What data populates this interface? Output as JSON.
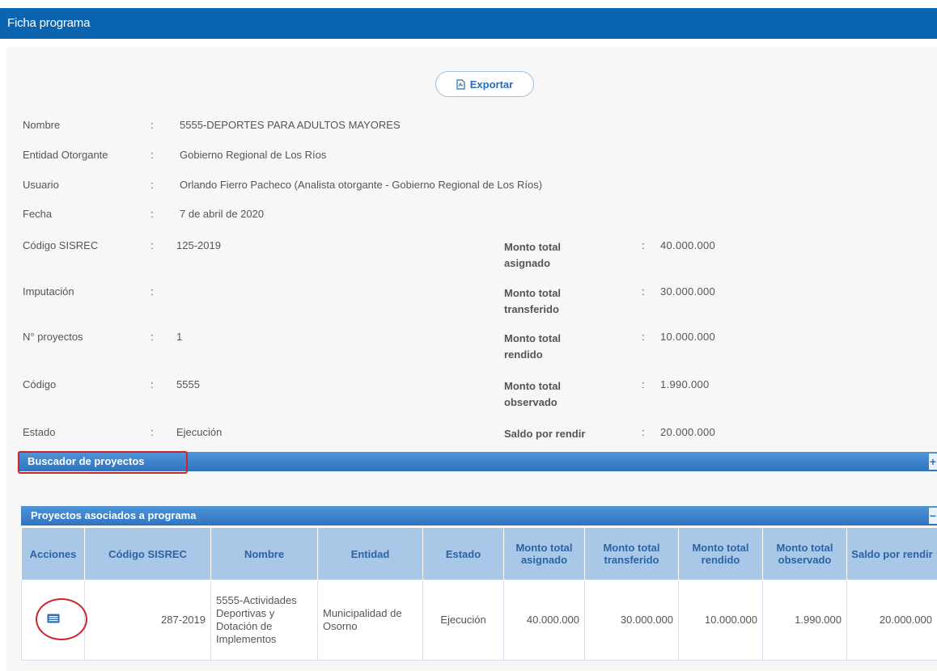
{
  "header": {
    "title": "Ficha programa"
  },
  "toolbar": {
    "export_label": "Exportar"
  },
  "info": {
    "nombre": {
      "label": "Nombre",
      "value": "5555-DEPORTES PARA ADULTOS MAYORES"
    },
    "entidad": {
      "label": "Entidad Otorgante",
      "value": "Gobierno Regional de Los Ríos"
    },
    "usuario": {
      "label": "Usuario",
      "value": "Orlando Fierro Pacheco (Analista otorgante - Gobierno Regional de Los Ríos)"
    },
    "fecha": {
      "label": "Fecha",
      "value": "7 de abril de 2020"
    },
    "colon": ":"
  },
  "details": {
    "codigo_sisrec": {
      "label": "Código SISREC",
      "value": "125-2019"
    },
    "imputacion": {
      "label": "Imputación",
      "value": ""
    },
    "n_proyectos": {
      "label": "N° proyectos",
      "value": "1"
    },
    "codigo": {
      "label": "Código",
      "value": "5555"
    },
    "estado": {
      "label": "Estado",
      "value": "Ejecución"
    },
    "monto_asignado": {
      "label": "Monto total asignado",
      "value": "40.000.000"
    },
    "monto_transferido": {
      "label": "Monto total transferido",
      "value": "30.000.000"
    },
    "monto_rendido": {
      "label": "Monto total rendido",
      "value": "10.000.000"
    },
    "monto_observado": {
      "label": "Monto total observado",
      "value": "1.990.000"
    },
    "saldo": {
      "label": "Saldo por rendir",
      "value": "20.000.000"
    }
  },
  "buscador": {
    "title": "Buscador de proyectos",
    "toggle": "+"
  },
  "proyectos": {
    "title": "Proyectos asociados a programa",
    "toggle": "−",
    "columns": [
      "Acciones",
      "Código SISREC",
      "Nombre",
      "Entidad",
      "Estado",
      "Monto total asignado",
      "Monto total transferido",
      "Monto total rendido",
      "Monto total observado",
      "Saldo por rendir"
    ],
    "rows": [
      {
        "codigo": "287-2019",
        "nombre": "5555-Actividades Deportivas y Dotación de Implementos",
        "entidad": "Municipalidad de Osorno",
        "estado": "Ejecución",
        "asignado": "40.000.000",
        "transferido": "30.000.000",
        "rendido": "10.000.000",
        "observado": "1.990.000",
        "saldo": "20.000.000"
      }
    ]
  },
  "colors": {
    "header": "#0a64b0",
    "bar": "#2f74c0",
    "table_header": "#a9c8e8",
    "highlight": "#d2232a"
  },
  "icons": {
    "export": "pdf-icon",
    "action": "list-view-icon"
  }
}
